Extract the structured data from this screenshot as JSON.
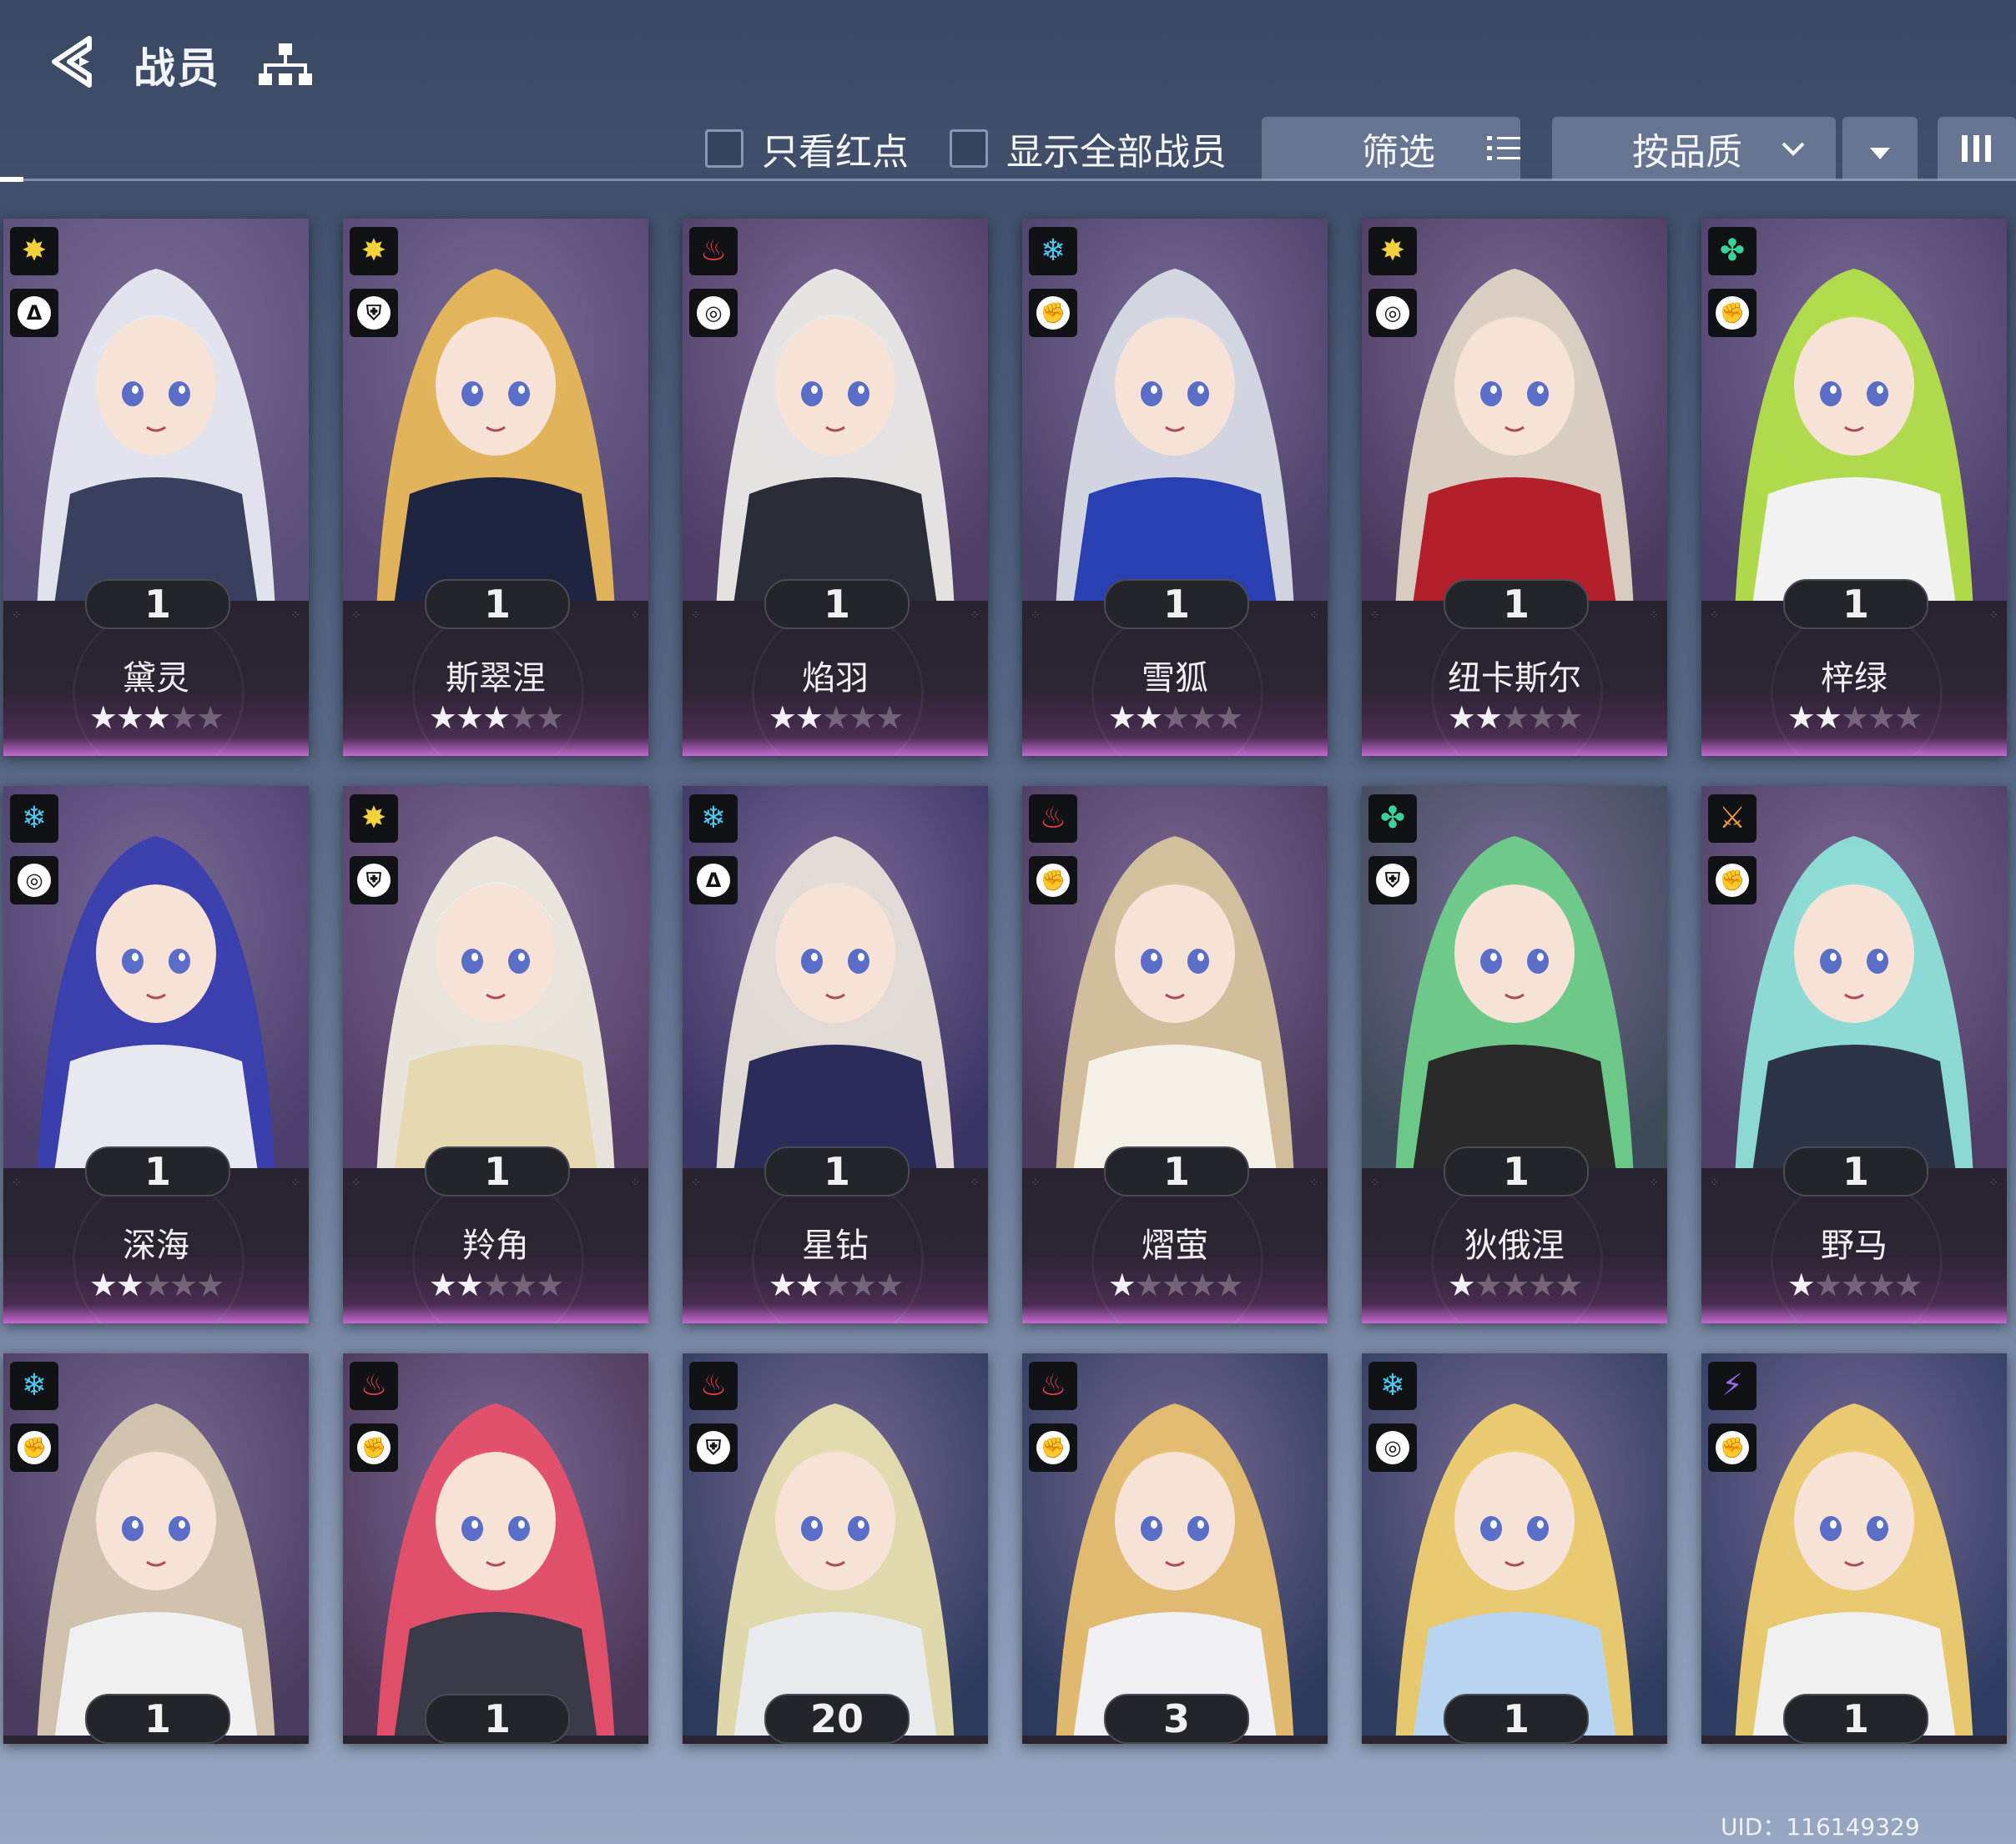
{
  "header": {
    "title": "战员",
    "only_red_dot": "只看红点",
    "show_all": "显示全部战员",
    "filter": "筛选",
    "sort_by": "按品质"
  },
  "colors": {
    "elem_gold": "#f2d23a",
    "elem_fire": "#e8404a",
    "elem_ice": "#4fc8ee",
    "elem_wind": "#39d39a",
    "elem_phys": "#f09a3a",
    "elem_thunder": "#9a6cf0",
    "rarity_glow": "#c46ad0"
  },
  "characters": [
    {
      "name": "黛灵",
      "count": "1",
      "stars": 3,
      "element": "gold",
      "role": "Δ",
      "hair": "#e8eaf2",
      "cloth": "#39405e",
      "bg": "#5a4f78"
    },
    {
      "name": "斯翠涅",
      "count": "1",
      "stars": 3,
      "element": "gold",
      "role": "⛨",
      "hair": "#e8b85a",
      "cloth": "#1f2440",
      "bg": "#564672"
    },
    {
      "name": "焰羽",
      "count": "1",
      "stars": 2,
      "element": "fire",
      "role": "◎",
      "hair": "#eceae8",
      "cloth": "#2a2c38",
      "bg": "#4e3e66"
    },
    {
      "name": "雪狐",
      "count": "1",
      "stars": 2,
      "element": "ice",
      "role": "✊",
      "hair": "#d8dce6",
      "cloth": "#2a3fb0",
      "bg": "#4a4068"
    },
    {
      "name": "纽卡斯尔",
      "count": "1",
      "stars": 2,
      "element": "gold",
      "role": "◎",
      "hair": "#ded4c4",
      "cloth": "#b3202c",
      "bg": "#4c3a5e"
    },
    {
      "name": "梓绿",
      "count": "1",
      "stars": 2,
      "element": "wind",
      "role": "✊",
      "hair": "#b4e04a",
      "cloth": "#f2f2f2",
      "bg": "#4e3f6a"
    },
    {
      "name": "深海",
      "count": "1",
      "stars": 2,
      "element": "ice",
      "role": "◎",
      "hair": "#3a3fb0",
      "cloth": "#e8e8f0",
      "bg": "#4c3f6c"
    },
    {
      "name": "羚角",
      "count": "1",
      "stars": 2,
      "element": "gold",
      "role": "⛨",
      "hair": "#f0ece0",
      "cloth": "#e6d8b0",
      "bg": "#553f66"
    },
    {
      "name": "星钻",
      "count": "1",
      "stars": 2,
      "element": "ice",
      "role": "Δ",
      "hair": "#e8e2da",
      "cloth": "#2c2c5a",
      "bg": "#3a3464"
    },
    {
      "name": "熠萤",
      "count": "1",
      "stars": 1,
      "element": "fire",
      "role": "✊",
      "hair": "#d8c49e",
      "cloth": "#f4f0e6",
      "bg": "#4a3a5c"
    },
    {
      "name": "狄俄涅",
      "count": "1",
      "stars": 1,
      "element": "wind",
      "role": "⛨",
      "hair": "#6fcf8a",
      "cloth": "#2a2a2a",
      "bg": "#3e4a58"
    },
    {
      "name": "野马",
      "count": "1",
      "stars": 1,
      "element": "phys",
      "role": "✊",
      "hair": "#8fe0d8",
      "cloth": "#2c3448",
      "bg": "#4e3e64"
    },
    {
      "name": "",
      "count": "1",
      "stars": 0,
      "element": "ice",
      "role": "✊",
      "hair": "#d6c8b0",
      "cloth": "#f0f0f0",
      "bg": "#4a3c5e"
    },
    {
      "name": "",
      "count": "1",
      "stars": 0,
      "element": "fire",
      "role": "✊",
      "hair": "#e8506a",
      "cloth": "#3a3a48",
      "bg": "#4a3656"
    },
    {
      "name": "",
      "count": "20",
      "stars": 0,
      "element": "fire",
      "role": "⛨",
      "hair": "#e8e0b0",
      "cloth": "#e8eaee",
      "bg": "#2c3a5c"
    },
    {
      "name": "",
      "count": "3",
      "stars": 0,
      "element": "fire",
      "role": "✊",
      "hair": "#e8c070",
      "cloth": "#f0f0f4",
      "bg": "#2c3a5c"
    },
    {
      "name": "",
      "count": "1",
      "stars": 0,
      "element": "ice",
      "role": "◎",
      "hair": "#f0d070",
      "cloth": "#b8d4f0",
      "bg": "#2e3c5e"
    },
    {
      "name": "",
      "count": "1",
      "stars": 0,
      "element": "thunder",
      "role": "✊",
      "hair": "#f0d070",
      "cloth": "#f0f0f0",
      "bg": "#2e3c60"
    }
  ],
  "footer": {
    "uid": "UID：116149329"
  }
}
